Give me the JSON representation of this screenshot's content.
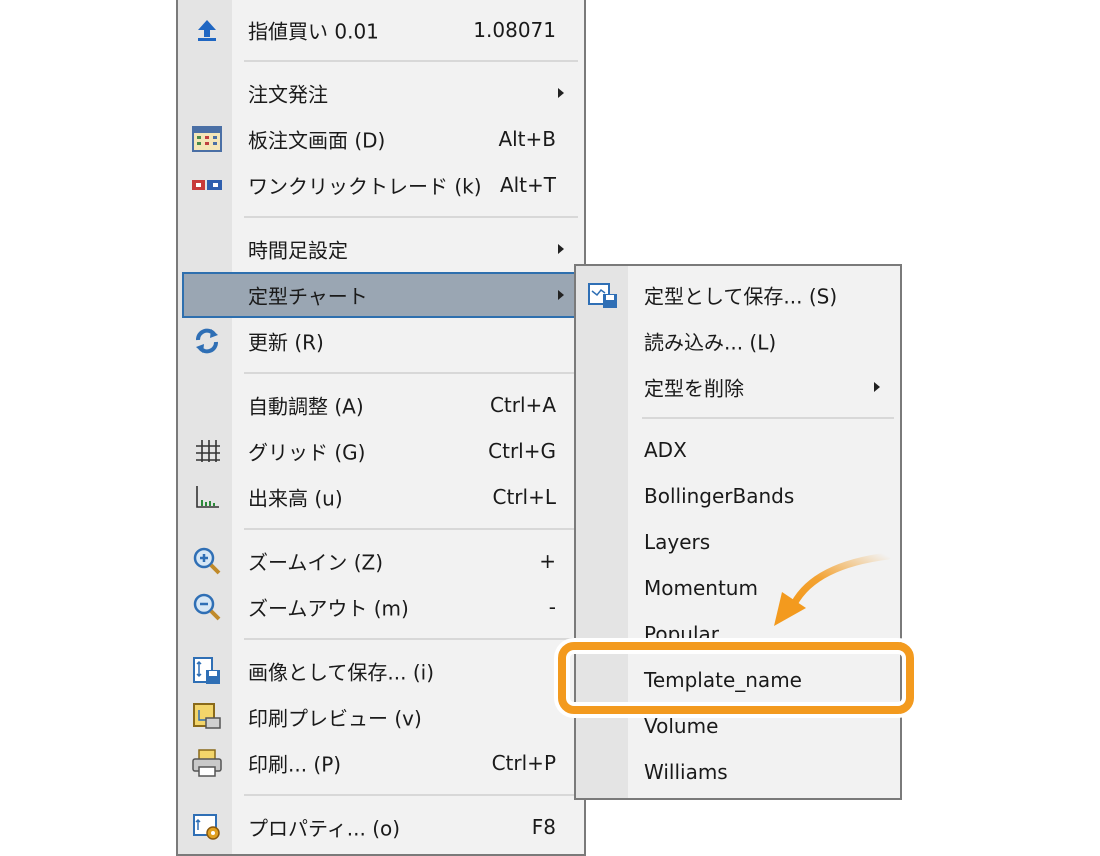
{
  "main_menu": {
    "items": [
      {
        "label": "指値買い 0.01",
        "shortcut": "1.08071",
        "icon": "buy-limit-arrow-icon",
        "submenu": false
      },
      {
        "label": "注文発注",
        "shortcut": "",
        "icon": "",
        "submenu": true
      },
      {
        "label": "板注文画面 (D)",
        "shortcut": "Alt+B",
        "icon": "order-board-icon",
        "submenu": false
      },
      {
        "label": "ワンクリックトレード (k)",
        "shortcut": "Alt+T",
        "icon": "one-click-trade-icon",
        "submenu": false
      },
      {
        "label": "時間足設定",
        "shortcut": "",
        "icon": "",
        "submenu": true
      },
      {
        "label": "定型チャート",
        "shortcut": "",
        "icon": "",
        "submenu": true,
        "highlighted": true
      },
      {
        "label": "更新 (R)",
        "shortcut": "",
        "icon": "refresh-icon",
        "submenu": false
      },
      {
        "label": "自動調整 (A)",
        "shortcut": "Ctrl+A",
        "icon": "",
        "submenu": false
      },
      {
        "label": "グリッド (G)",
        "shortcut": "Ctrl+G",
        "icon": "grid-icon",
        "submenu": false
      },
      {
        "label": "出来高 (u)",
        "shortcut": "Ctrl+L",
        "icon": "volume-icon",
        "submenu": false
      },
      {
        "label": "ズームイン (Z)",
        "shortcut": "+",
        "icon": "zoom-in-icon",
        "submenu": false
      },
      {
        "label": "ズームアウト (m)",
        "shortcut": "-",
        "icon": "zoom-out-icon",
        "submenu": false
      },
      {
        "label": "画像として保存... (i)",
        "shortcut": "",
        "icon": "save-image-icon",
        "submenu": false
      },
      {
        "label": "印刷プレビュー (v)",
        "shortcut": "",
        "icon": "print-preview-icon",
        "submenu": false
      },
      {
        "label": "印刷... (P)",
        "shortcut": "Ctrl+P",
        "icon": "printer-icon",
        "submenu": false
      },
      {
        "label": "プロパティ... (o)",
        "shortcut": "F8",
        "icon": "properties-icon",
        "submenu": false
      }
    ]
  },
  "sub_menu": {
    "items": [
      {
        "label": "定型として保存... (S)",
        "icon": "save-template-icon",
        "submenu": false
      },
      {
        "label": "読み込み... (L)",
        "icon": "",
        "submenu": false
      },
      {
        "label": "定型を削除",
        "icon": "",
        "submenu": true
      },
      {
        "label": "ADX",
        "icon": "",
        "submenu": false
      },
      {
        "label": "BollingerBands",
        "icon": "",
        "submenu": false
      },
      {
        "label": "Layers",
        "icon": "",
        "submenu": false
      },
      {
        "label": "Momentum",
        "icon": "",
        "submenu": false
      },
      {
        "label": "Popular",
        "icon": "",
        "submenu": false
      },
      {
        "label": "Template_name",
        "icon": "",
        "submenu": false,
        "callout": true
      },
      {
        "label": "Volume",
        "icon": "",
        "submenu": false
      },
      {
        "label": "Williams",
        "icon": "",
        "submenu": false
      }
    ]
  },
  "colors": {
    "highlight_bg": "#9aa6b3",
    "highlight_border": "#2e6fae",
    "callout": "#f39a1e"
  }
}
